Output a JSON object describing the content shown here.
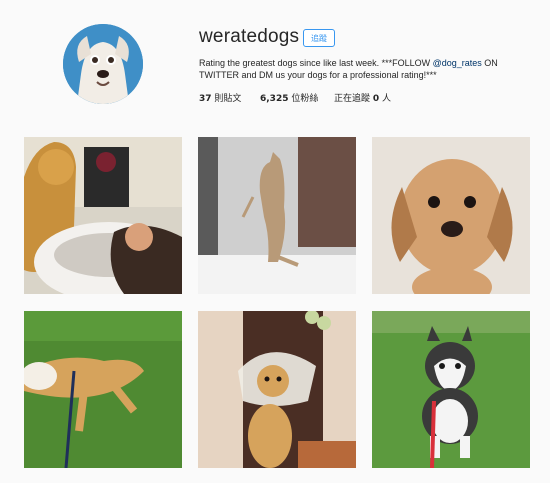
{
  "profile": {
    "username": "weratedogs",
    "follow_label": "追蹤",
    "bio_part1": "Rating the greatest dogs since like last week. ***FOLLOW ",
    "bio_mention": "@dog_rates",
    "bio_part2": " ON TWITTER and DM us your dogs for a professional rating!***",
    "posts_count": "37",
    "posts_label": " 則貼文",
    "followers_count": "6,325",
    "followers_label": " 位粉絲",
    "following_label": "正在追蹤 ",
    "following_count": "0",
    "following_suffix": " 人"
  },
  "grid": [
    "photo-golden-retriever-hair-salon",
    "photo-kangaroo",
    "photo-dachshund-puppy",
    "photo-dog-rolling-on-grass",
    "photo-dog-with-cone",
    "photo-husky-puppy-on-grass"
  ]
}
